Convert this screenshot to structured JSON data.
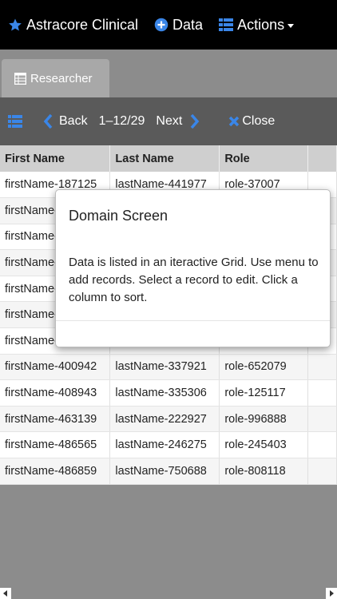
{
  "navbar": {
    "brand": "Astracore Clinical",
    "data_label": "Data",
    "actions_label": "Actions",
    "icons": [
      "star-icon",
      "plus-circle-icon",
      "grid-icon",
      "caret-down-icon"
    ]
  },
  "tabs": [
    {
      "label": "Researcher",
      "icon": "table-icon"
    }
  ],
  "toolbar": {
    "back_label": "Back",
    "range_label": "1–12/29",
    "next_label": "Next",
    "close_label": "Close"
  },
  "grid": {
    "columns": [
      "First Name",
      "Last Name",
      "Role",
      ""
    ],
    "rows": [
      [
        "firstName-187125",
        "lastName-441977",
        "role-37007"
      ],
      [
        "firstName-",
        "",
        ""
      ],
      [
        "firstName-",
        "",
        ""
      ],
      [
        "firstName-",
        "",
        ""
      ],
      [
        "firstName-",
        "",
        ""
      ],
      [
        "firstName-",
        "",
        ""
      ],
      [
        "firstName-",
        "",
        ""
      ],
      [
        "firstName-400942",
        "lastName-337921",
        "role-652079"
      ],
      [
        "firstName-408943",
        "lastName-335306",
        "role-125117"
      ],
      [
        "firstName-463139",
        "lastName-222927",
        "role-996888"
      ],
      [
        "firstName-486565",
        "lastName-246275",
        "role-245403"
      ],
      [
        "firstName-486859",
        "lastName-750688",
        "role-808118"
      ]
    ]
  },
  "modal": {
    "title": "Domain Screen",
    "body": "Data is listed in an iteractive Grid. Use menu to add records. Select a record to edit. Click a column to sort."
  },
  "colors": {
    "navbar_bg": "#000000",
    "accent_blue": "#3a86e8",
    "toolbar_bg": "#5a5a5a",
    "page_bg": "#8c8c8c",
    "tab_bg": "#a8a8a8",
    "header_bg": "#cfcfcf"
  }
}
